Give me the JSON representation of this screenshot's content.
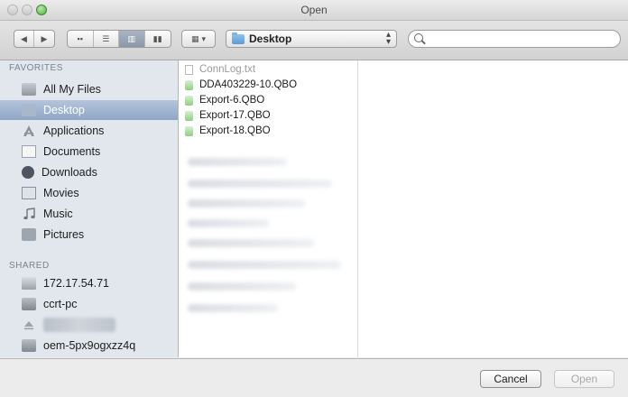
{
  "window": {
    "title": "Open"
  },
  "toolbar": {
    "location_label": "Desktop",
    "search_placeholder": "",
    "arrange_label": "▾"
  },
  "sidebar": {
    "favorites_header": "FAVORITES",
    "shared_header": "SHARED",
    "favorites": [
      {
        "label": "All My Files",
        "icon": "all-my-files-icon"
      },
      {
        "label": "Desktop",
        "icon": "desktop-icon",
        "selected": true
      },
      {
        "label": "Applications",
        "icon": "applications-icon"
      },
      {
        "label": "Documents",
        "icon": "documents-icon"
      },
      {
        "label": "Downloads",
        "icon": "downloads-icon"
      },
      {
        "label": "Movies",
        "icon": "movies-icon"
      },
      {
        "label": "Music",
        "icon": "music-icon"
      },
      {
        "label": "Pictures",
        "icon": "pictures-icon"
      }
    ],
    "shared": [
      {
        "label": "172.17.54.71",
        "icon": "network-server-icon"
      },
      {
        "label": "ccrt-pc",
        "icon": "pc-icon"
      },
      {
        "label": "",
        "icon": "eject-icon",
        "blurred": true
      },
      {
        "label": "oem-5px9ogxzz4q",
        "icon": "pc-icon"
      }
    ]
  },
  "files": [
    {
      "name": "ConnLog.txt",
      "type": "txt",
      "enabled": false
    },
    {
      "name": "DDA403229-10.QBO",
      "type": "qbo",
      "enabled": true
    },
    {
      "name": "Export-6.QBO",
      "type": "qbo",
      "enabled": true
    },
    {
      "name": "Export-17.QBO",
      "type": "qbo",
      "enabled": true
    },
    {
      "name": "Export-18.QBO",
      "type": "qbo",
      "enabled": true
    }
  ],
  "buttons": {
    "cancel": "Cancel",
    "open": "Open"
  },
  "colors": {
    "selection": "#8fa6c6",
    "sidebar_bg": "#e2e7ed"
  }
}
